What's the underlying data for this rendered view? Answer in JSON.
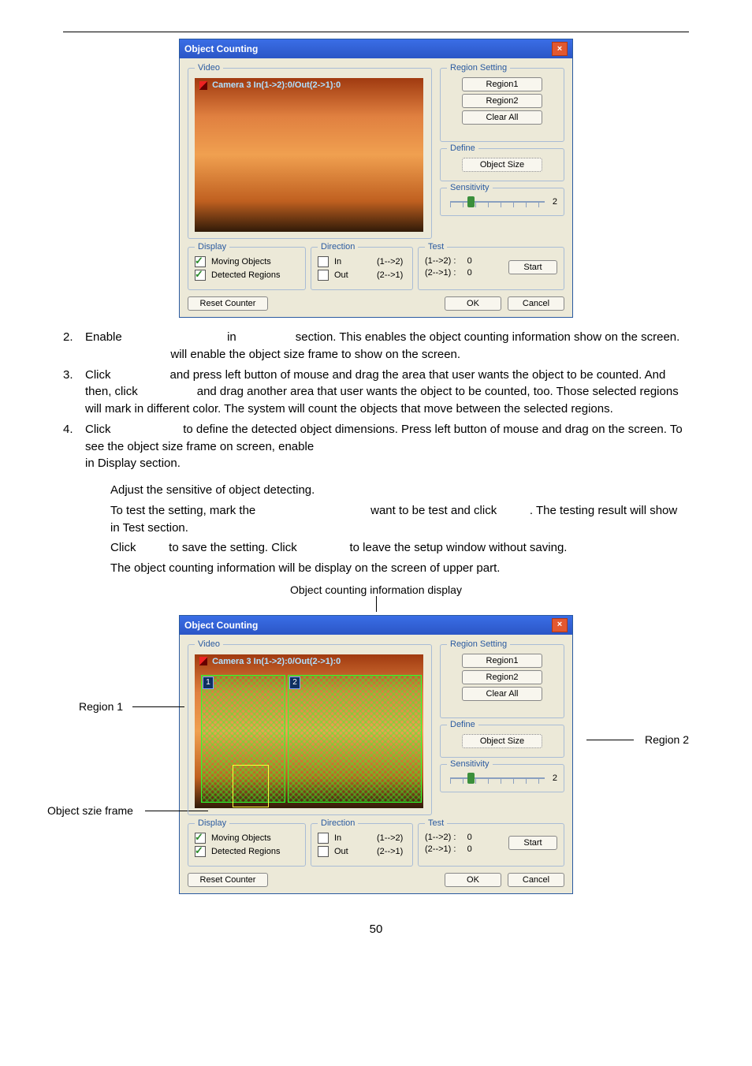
{
  "page_number": "50",
  "dialog": {
    "title": "Object Counting",
    "video_legend": "Video",
    "video_overlay": "Camera 3 In(1->2):0/Out(2->1):0",
    "region_setting": {
      "legend": "Region Setting",
      "region1": "Region1",
      "region2": "Region2",
      "clear_all": "Clear All"
    },
    "define": {
      "legend": "Define",
      "object_size": "Object Size"
    },
    "sensitivity": {
      "legend": "Sensitivity",
      "value": "2"
    },
    "display": {
      "legend": "Display",
      "moving_objects": "Moving Objects",
      "detected_regions_1": "Detected Regions",
      "detected_regions_2": "Detected Regions"
    },
    "direction": {
      "legend": "Direction",
      "in_lbl": "In",
      "in_val": "(1-->2)",
      "out_lbl": "Out",
      "out_val": "(2-->1)"
    },
    "test": {
      "legend": "Test",
      "r1": "(1-->2) :",
      "r2": "(2-->1) :",
      "v1": "0",
      "v2": "0",
      "start": "Start"
    },
    "reset_counter": "Reset Counter",
    "ok": "OK",
    "cancel": "Cancel"
  },
  "instructions": {
    "n2": "2.",
    "t2a": "Enable ",
    "t2b": " in ",
    "t2c": " section. This enables the object counting information show on the screen. ",
    "t2d": " will enable the object size frame to show on the screen.",
    "n3": "3.",
    "t3a": "Click ",
    "t3b": " and press left button of mouse and drag the area that user wants the object to be counted. And then, click ",
    "t3c": " and drag another area that user wants the object to be counted, too. Those selected regions will mark in different color. The system will count the objects that move between the selected regions.",
    "n4": "4.",
    "t4a": "Click ",
    "t4b": " to define the detected object dimensions. Press left button of mouse and drag on the screen. To see the object size frame on screen, enable ",
    "t4c": "in Display section.",
    "sub": {
      "s5": "Adjust the sensitive of object detecting.",
      "s6a": "To test the setting, mark the ",
      "s6b": " want to be test and click ",
      "s6c": ". The testing result will show in Test section.",
      "s7a": "Click ",
      "s7b": " to save the setting. Click ",
      "s7c": " to leave the setup window without saving.",
      "s8": "The object counting information will be display on the screen of upper part."
    }
  },
  "caption": "Object counting information display",
  "annot": {
    "region1": "Region 1",
    "region2": "Region 2",
    "objsize": "Object szie frame"
  }
}
